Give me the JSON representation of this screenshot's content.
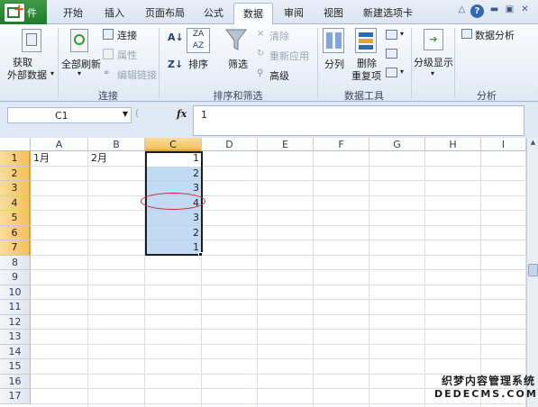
{
  "tabs": {
    "file": "件",
    "home": "开始",
    "insert": "插入",
    "page_layout": "页面布局",
    "formulas": "公式",
    "data": "数据",
    "review": "审阅",
    "view": "视图",
    "new_tab": "新建选项卡"
  },
  "ribbon": {
    "get_external_1": "获取",
    "get_external_2": "外部数据",
    "refresh_all": "全部刷新",
    "connections": "连接",
    "properties": "属性",
    "edit_links": "编辑链接",
    "group_connections": "连接",
    "sort": "排序",
    "filter": "筛选",
    "clear": "清除",
    "reapply": "重新应用",
    "advanced": "高级",
    "group_sort_filter": "排序和筛选",
    "text_to_columns": "分列",
    "remove_duplicates_1": "删除",
    "remove_duplicates_2": "重复项",
    "group_data_tools": "数据工具",
    "outline": "分级显示",
    "data_analysis": "数据分析",
    "group_analysis": "分析"
  },
  "formula_bar": {
    "name_box": "C1",
    "fx": "fx",
    "value": "1"
  },
  "sheet": {
    "columns": [
      "A",
      "B",
      "C",
      "D",
      "E",
      "F",
      "G",
      "H",
      "I"
    ],
    "rows": [
      "1",
      "2",
      "3",
      "4",
      "5",
      "6",
      "7",
      "8",
      "9",
      "10",
      "11",
      "12",
      "13",
      "14",
      "15",
      "16",
      "17"
    ],
    "cells": {
      "A1": "1月",
      "B1": "2月",
      "C1": "1",
      "C2": "2",
      "C3": "3",
      "C4": "4",
      "C5": "3",
      "C6": "2",
      "C7": "1"
    },
    "selected_column": "C",
    "selected_rows": [
      1,
      7
    ]
  },
  "watermark": {
    "line1": "织梦内容管理系统",
    "line2": "DEDECMS.COM"
  },
  "colors": {
    "selection_fill": "#adcdf0",
    "highlight_ellipse": "#d42424",
    "file_tab": "#1f7a2b"
  }
}
